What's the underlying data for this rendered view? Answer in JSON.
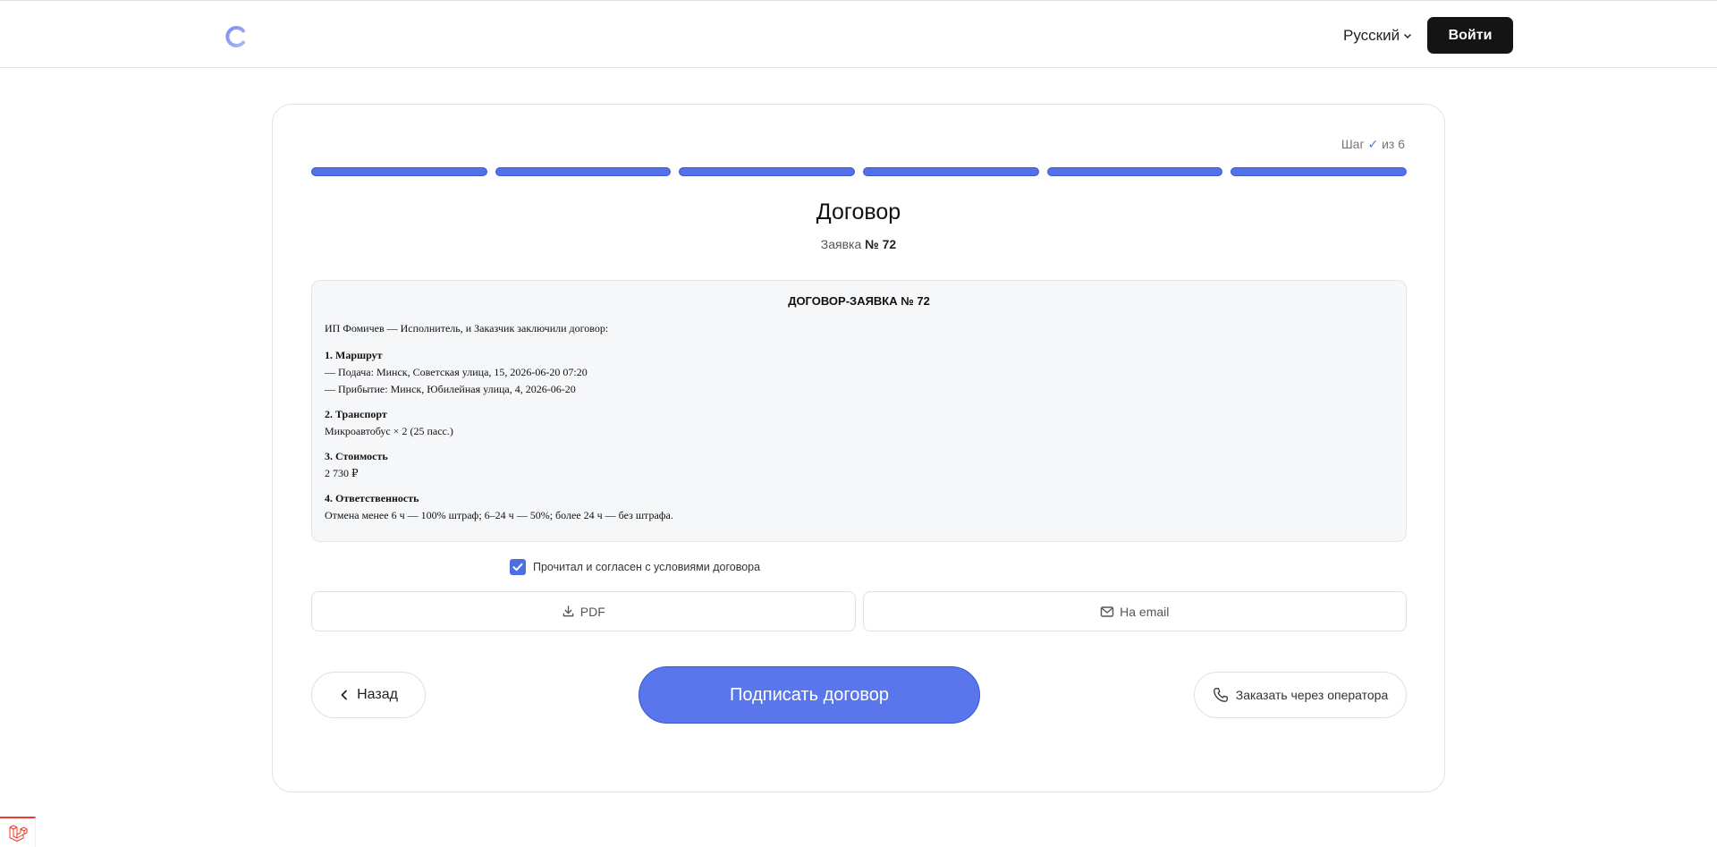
{
  "header": {
    "logo_icon": "circular-logo-icon",
    "language": "Русский",
    "login_label": "Войти"
  },
  "wizard": {
    "step_prefix": "Шаг",
    "step_current": "✓",
    "step_suffix": "из 6",
    "total_steps": 6,
    "completed_steps": 6,
    "accent_color": "#5470e8"
  },
  "page": {
    "title": "Договор",
    "subtitle_prefix": "Заявка",
    "subtitle_number": "№ 72"
  },
  "contract": {
    "heading": "ДОГОВОР-ЗАЯВКА № 72",
    "intro": "ИП Фомичев — Исполнитель, и Заказчик заключили договор:",
    "sections": [
      {
        "title": "1. Маршрут",
        "lines": [
          "— Подача: Минск, Советская улица, 15, 2026-06-20 07:20",
          "— Прибытие: Минск, Юбилейная улица, 4, 2026-06-20"
        ]
      },
      {
        "title": "2. Транспорт",
        "lines": [
          "Микроавтобус × 2 (25 пасс.)"
        ]
      },
      {
        "title": "3. Стоимость",
        "lines": [
          "2 730 ₽"
        ]
      },
      {
        "title": "4. Ответственность",
        "lines": [
          "Отмена менее 6 ч — 100% штраф; 6–24 ч — 50%; более 24 ч — без штрафа."
        ]
      }
    ]
  },
  "agreement": {
    "checked": true,
    "label": "Прочитал и согласен с условиями договора"
  },
  "doc_actions": {
    "pdf_label": "PDF",
    "pdf_icon": "download-icon",
    "email_label": "На email",
    "email_icon": "mail-icon"
  },
  "footer_actions": {
    "back_label": "Назад",
    "back_icon": "chevron-left-icon",
    "sign_label": "Подписать договор",
    "operator_label": "Заказать через оператора",
    "operator_icon": "phone-icon"
  },
  "debug_badge_icon": "laravel-icon"
}
